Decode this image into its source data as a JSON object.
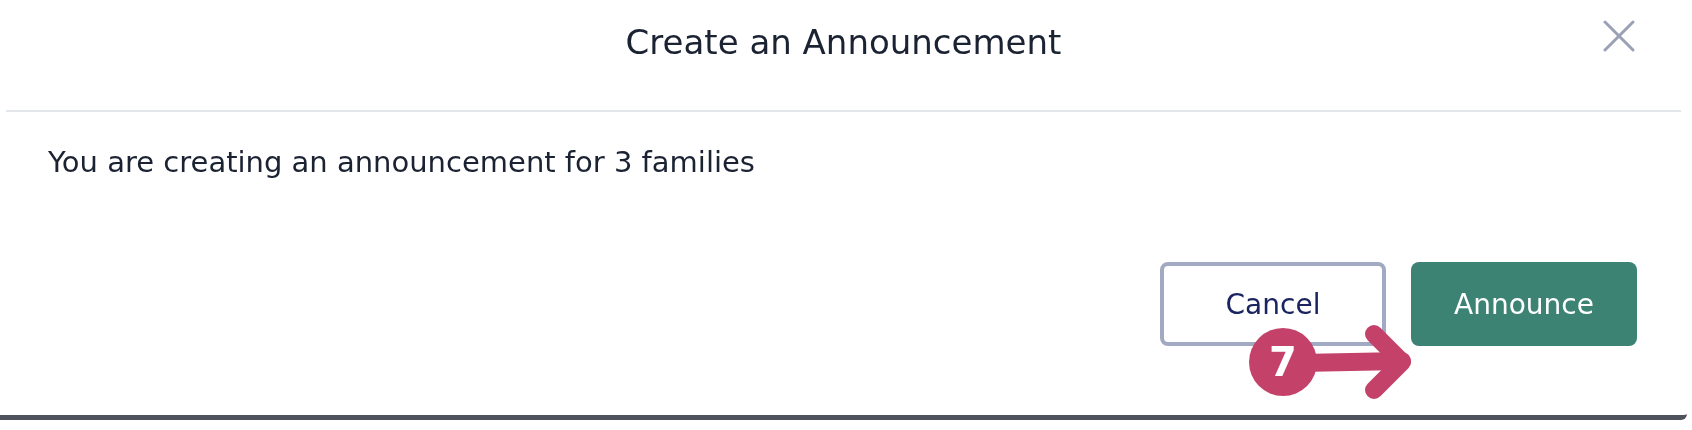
{
  "dialog": {
    "title": "Create an Announcement",
    "message": "You are creating an announcement for 3 families",
    "buttons": [
      {
        "label": "Cancel",
        "kind": "secondary"
      },
      {
        "label": "Announce",
        "kind": "primary"
      }
    ]
  },
  "annotation": {
    "step": "7"
  }
}
